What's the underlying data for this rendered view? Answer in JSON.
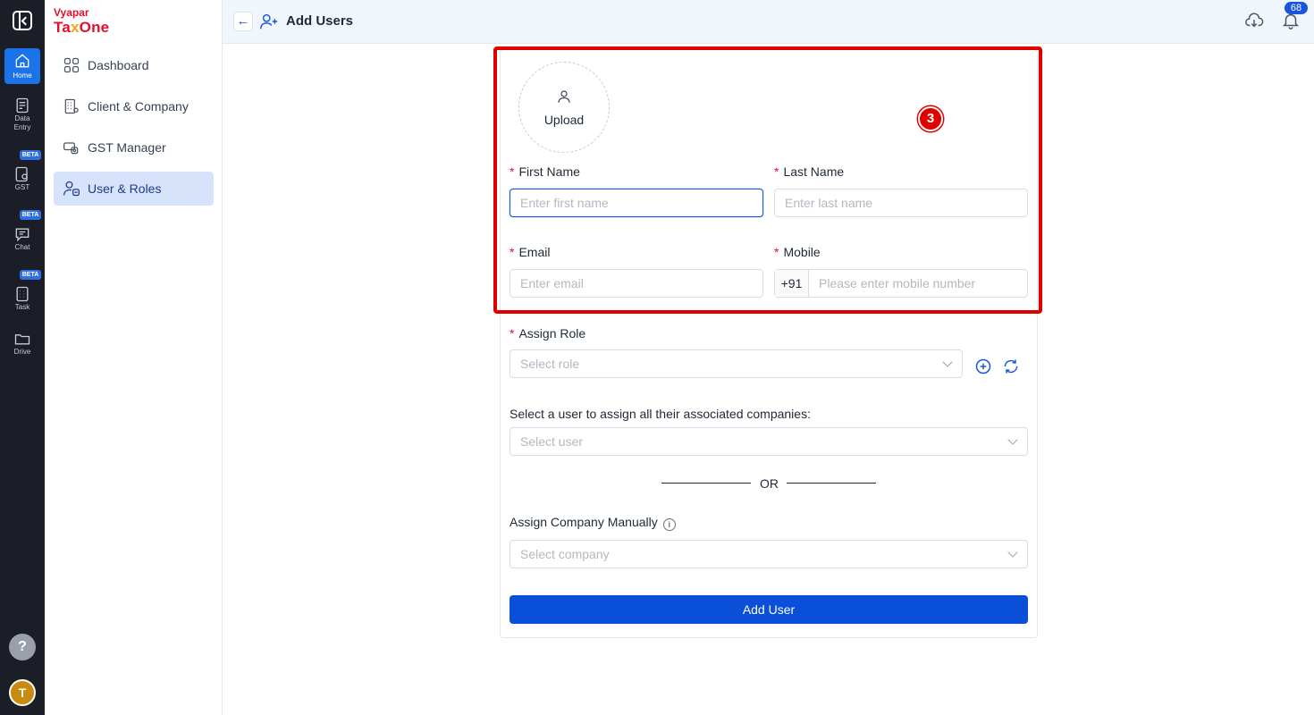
{
  "rail": {
    "items": [
      {
        "label": "Home",
        "icon": "home-icon",
        "active": true
      },
      {
        "label": "Data Entry",
        "icon": "data-entry-icon"
      },
      {
        "label": "GST",
        "icon": "gst-icon",
        "badge": "BETA"
      },
      {
        "label": "Chat",
        "icon": "chat-icon",
        "badge": "BETA"
      },
      {
        "label": "Task",
        "icon": "task-icon",
        "badge": "BETA"
      },
      {
        "label": "Drive",
        "icon": "folder-icon"
      }
    ],
    "help_label": "?",
    "avatar_initial": "T"
  },
  "brand": {
    "top": "Vyapar",
    "main_a": "Ta",
    "main_x": "x",
    "main_b": "One",
    "primary_color": "#e0122e",
    "accent_color": "#f3a21b"
  },
  "sidebar": {
    "items": [
      {
        "label": "Dashboard",
        "icon": "dashboard-icon"
      },
      {
        "label": "Client & Company",
        "icon": "building-icon"
      },
      {
        "label": "GST Manager",
        "icon": "gst-manager-icon"
      },
      {
        "label": "User & Roles",
        "icon": "user-roles-icon",
        "active": true
      }
    ]
  },
  "header": {
    "title": "Add Users",
    "notification_count": "68"
  },
  "form": {
    "upload_label": "Upload",
    "step_number": "3",
    "first_name": {
      "label": "First Name",
      "placeholder": "Enter first name",
      "value": ""
    },
    "last_name": {
      "label": "Last Name",
      "placeholder": "Enter last name",
      "value": ""
    },
    "email": {
      "label": "Email",
      "placeholder": "Enter email",
      "value": ""
    },
    "mobile": {
      "label": "Mobile",
      "prefix": "+91",
      "placeholder": "Please enter mobile number",
      "value": ""
    },
    "role": {
      "label": "Assign Role",
      "placeholder": "Select role"
    },
    "assoc_user": {
      "label": "Select a user to assign all their associated companies:",
      "placeholder": "Select user"
    },
    "or_text": "OR",
    "company": {
      "label": "Assign Company Manually",
      "placeholder": "Select company"
    },
    "submit_label": "Add User",
    "required_mark": "*"
  },
  "colors": {
    "primary_button": "#0a4fd8",
    "highlight": "#e00000",
    "active_nav": "#d6e3fb"
  }
}
